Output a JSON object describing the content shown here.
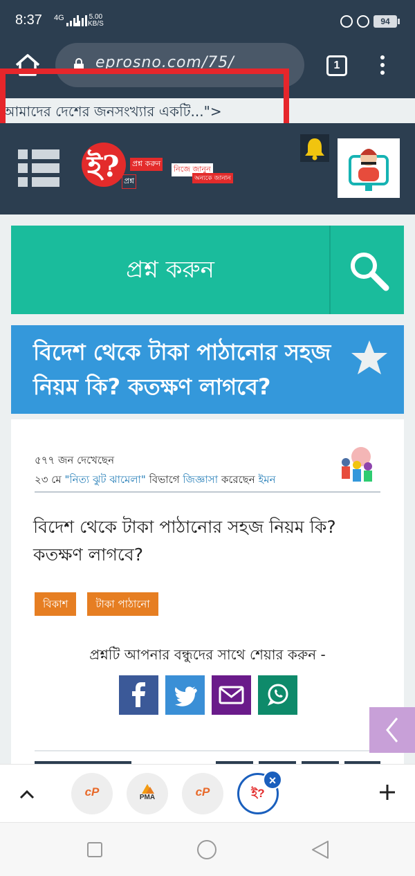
{
  "status_bar": {
    "time": "8:37",
    "network": "4G",
    "speed_value": "5.00",
    "speed_unit": "KB/S",
    "battery": "94"
  },
  "browser": {
    "url": "eprosno.com/75/",
    "tab_count": "1"
  },
  "ticker": {
    "text": "আমাদের দেশের জনসংখ্যার একটি...\">"
  },
  "site": {
    "logo_mark": "ই?",
    "logo_tagline_1": "প্রশ্ন করুন",
    "logo_tagline_2": "নিজে জানুন",
    "logo_tagline_3": "প্রশ্ন",
    "logo_tagline_4": "অন্যকে জানান"
  },
  "ask_bar": {
    "label": "প্রশ্ন করুন"
  },
  "question": {
    "title": "বিদেশ থেকে টাকা পাঠানোর সহজ নিয়ম কি? কতক্ষণ লাগবে?",
    "views": "৫৭৭ জন দেখেছেন",
    "date": "২৩ মে",
    "category": "\"নিত্য ঝুট ঝামেলা\"",
    "in_section": "বিভাগে",
    "action": "জিজ্ঞাসা",
    "action_suffix": "করেছেন",
    "author": "ইমন",
    "body": "বিদেশ থেকে টাকা পাঠানোর সহজ নিয়ম কি? কতক্ষণ লাগবে?",
    "tags": [
      "বিকাশ",
      "টাকা পাঠানো"
    ],
    "share_label": "প্রশ্নটি আপনার বন্ধুদের সাথে শেয়ার করুন -"
  },
  "share_buttons": [
    {
      "name": "facebook",
      "color": "#3b5998"
    },
    {
      "name": "twitter",
      "color": "#3a8fd6"
    },
    {
      "name": "email",
      "color": "#6a1b8a"
    },
    {
      "name": "whatsapp",
      "color": "#0e8a6a"
    }
  ],
  "tab_strip": {
    "tabs": [
      {
        "label": "cP",
        "icon": "cpanel-icon"
      },
      {
        "label": "PMA",
        "icon": "phpmyadmin-icon"
      },
      {
        "label": "cP",
        "icon": "cpanel-icon"
      },
      {
        "label": "ই?",
        "icon": "eprosno-icon"
      }
    ]
  },
  "colors": {
    "header_bg": "#2c3e50",
    "teal": "#1abc9c",
    "blue": "#3498db",
    "tag_orange": "#e67e22",
    "highlight_red": "#e6262b"
  }
}
